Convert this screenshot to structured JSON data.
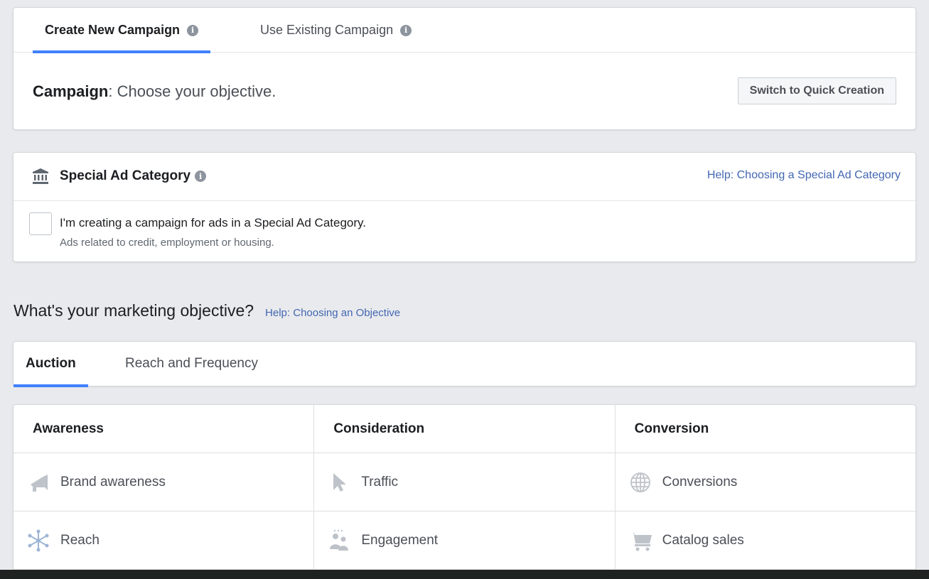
{
  "campaign_tabs": [
    {
      "label": "Create New Campaign",
      "active": true
    },
    {
      "label": "Use Existing Campaign",
      "active": false
    }
  ],
  "campaign": {
    "label_bold": "Campaign",
    "label_rest": ": Choose your objective.",
    "quick_button": "Switch to Quick Creation"
  },
  "special": {
    "icon": "bank-icon",
    "title": "Special Ad Category",
    "help": "Help: Choosing a Special Ad Category",
    "checkbox_label": "I'm creating a campaign for ads in a Special Ad Category.",
    "checkbox_sub": "Ads related to credit, employment or housing.",
    "checked": false
  },
  "objective": {
    "question": "What's your marketing objective?",
    "help": "Help: Choosing an Objective"
  },
  "buy_tabs": [
    {
      "label": "Auction",
      "active": true
    },
    {
      "label": "Reach and Frequency",
      "active": false
    }
  ],
  "columns": [
    {
      "title": "Awareness",
      "items": [
        {
          "label": "Brand awareness",
          "icon": "megaphone-icon"
        },
        {
          "label": "Reach",
          "icon": "reach-icon"
        }
      ]
    },
    {
      "title": "Consideration",
      "items": [
        {
          "label": "Traffic",
          "icon": "cursor-icon"
        },
        {
          "label": "Engagement",
          "icon": "people-icon"
        }
      ]
    },
    {
      "title": "Conversion",
      "items": [
        {
          "label": "Conversions",
          "icon": "globe-icon"
        },
        {
          "label": "Catalog sales",
          "icon": "cart-icon"
        }
      ]
    }
  ],
  "colors": {
    "accent": "#4080ff",
    "link": "#4267b2",
    "icon_gray": "#bec3c9",
    "background": "#e9eaed"
  }
}
